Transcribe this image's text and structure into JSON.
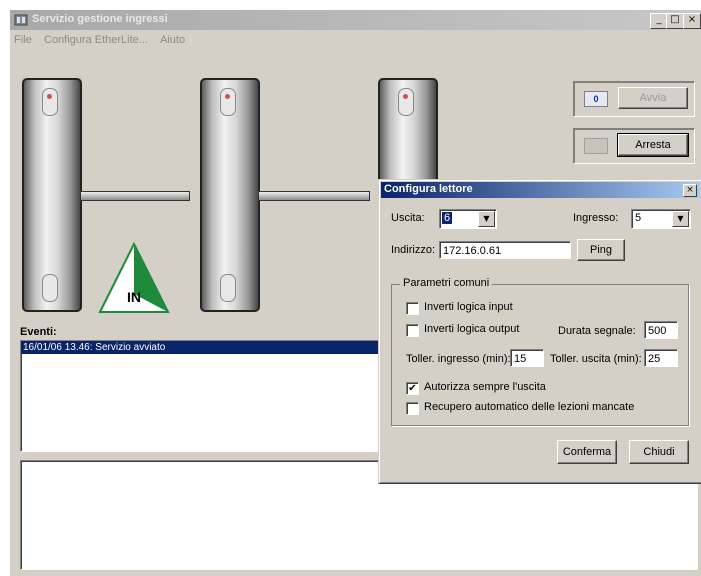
{
  "window": {
    "title": "Servizio gestione ingressi",
    "minimize_glyph": "_",
    "maximize_glyph": "□",
    "close_glyph": "×"
  },
  "menu": {
    "items": [
      "File",
      "Configura EtherLite...",
      "Aiuto"
    ]
  },
  "scene": {
    "direction_sign": "IN",
    "sign_colors": {
      "fill": "#1f8a3a",
      "text": "#000000"
    }
  },
  "controls": {
    "avvia_indicator": "0",
    "avvia_label": "Avvia",
    "arresta_label": "Arresta"
  },
  "events": {
    "label": "Eventi:",
    "items": [
      "16/01/06 13.46: Servizio avviato"
    ]
  },
  "dialog": {
    "title": "Configura lettore",
    "close_glyph": "×",
    "uscita_label": "Uscita:",
    "uscita_value": "6",
    "ingresso_label": "Ingresso:",
    "ingresso_value": "5",
    "indirizzo_label": "Indirizzo:",
    "indirizzo_value": "172.16.0.61",
    "ping_label": "Ping",
    "group_label": "Parametri comuni",
    "inverti_input_label": "Inverti logica input",
    "inverti_input_checked": false,
    "inverti_output_label": "Inverti logica output",
    "inverti_output_checked": false,
    "durata_label": "Durata segnale:",
    "durata_value": "500",
    "toller_ingresso_label": "Toller. ingresso (min):",
    "toller_ingresso_value": "15",
    "toller_uscita_label": "Toller. uscita (min):",
    "toller_uscita_value": "25",
    "autorizza_label": "Autorizza sempre l'uscita",
    "autorizza_checked": true,
    "recupero_label": "Recupero automatico delle lezioni mancate",
    "recupero_checked": false,
    "conferma_label": "Conferma",
    "chiudi_label": "Chiudi",
    "check_glyph": "✔"
  },
  "colors": {
    "selection": "#0a246a",
    "window_face": "#d4d0c8",
    "dialog_title_start": "#0a246a",
    "dialog_title_end": "#a6caf0"
  }
}
